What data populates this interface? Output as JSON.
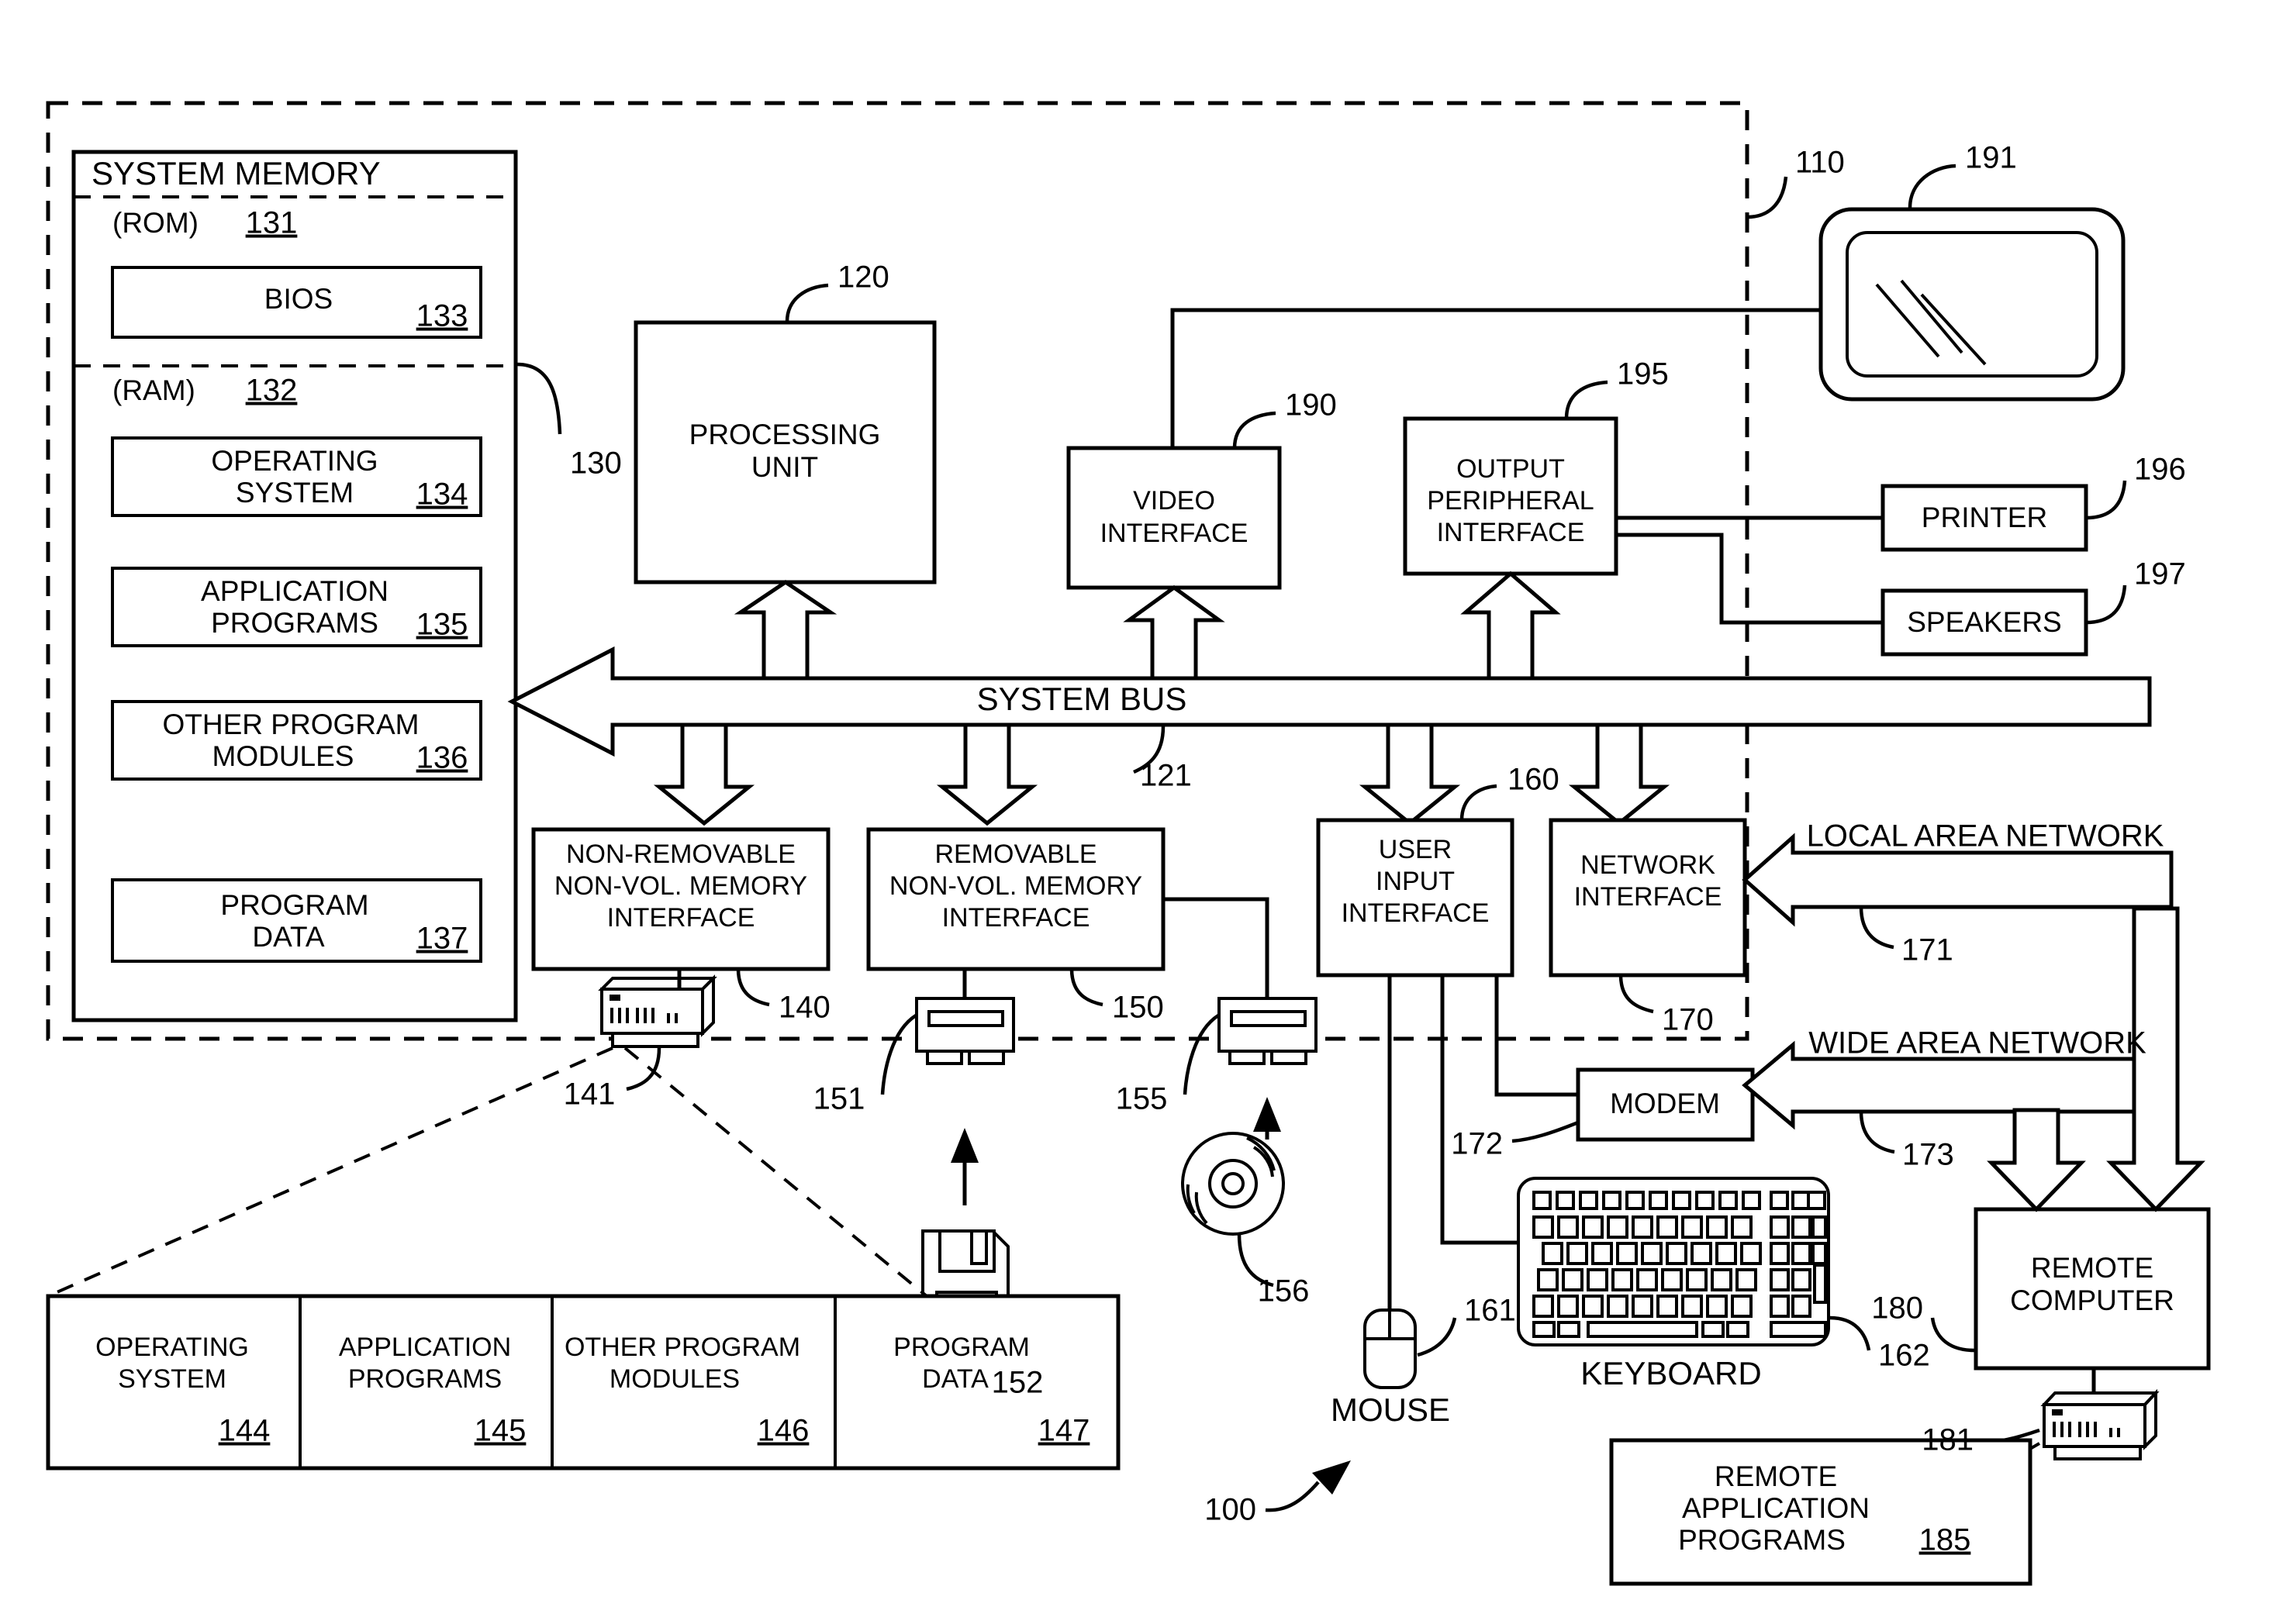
{
  "figure": {
    "system_ref": "100",
    "computer_ref": "110",
    "bus_label": "SYSTEM BUS",
    "bus_ref": "121"
  },
  "system_memory": {
    "title": "SYSTEM MEMORY",
    "ref": "130",
    "rom": {
      "label": "(ROM)",
      "ref": "131"
    },
    "bios": {
      "label": "BIOS",
      "ref": "133"
    },
    "ram": {
      "label": "(RAM)",
      "ref": "132"
    },
    "blocks": [
      {
        "line1": "OPERATING",
        "line2": "SYSTEM",
        "ref": "134"
      },
      {
        "line1": "APPLICATION",
        "line2": "PROGRAMS",
        "ref": "135"
      },
      {
        "line1": "OTHER PROGRAM",
        "line2": "MODULES",
        "ref": "136"
      },
      {
        "line1": "PROGRAM",
        "line2": "DATA",
        "ref": "137"
      }
    ]
  },
  "processing_unit": {
    "line1": "PROCESSING",
    "line2": "UNIT",
    "ref": "120"
  },
  "interfaces": {
    "video": {
      "line1": "VIDEO",
      "line2": "INTERFACE",
      "ref": "190"
    },
    "output_peripheral": {
      "line1": "OUTPUT",
      "line2": "PERIPHERAL",
      "line3": "INTERFACE",
      "ref": "195"
    },
    "non_removable": {
      "line1": "NON-REMOVABLE",
      "line2": "NON-VOL. MEMORY",
      "line3": "INTERFACE",
      "ref": "140"
    },
    "removable": {
      "line1": "REMOVABLE",
      "line2": "NON-VOL. MEMORY",
      "line3": "INTERFACE",
      "ref": "150"
    },
    "user_input": {
      "line1": "USER",
      "line2": "INPUT",
      "line3": "INTERFACE",
      "ref": "160"
    },
    "network": {
      "line1": "NETWORK",
      "line2": "INTERFACE",
      "ref": "170"
    }
  },
  "output_devices": {
    "monitor": {
      "ref": "191"
    },
    "printer": {
      "label": "PRINTER",
      "ref": "196"
    },
    "speakers": {
      "label": "SPEAKERS",
      "ref": "197"
    }
  },
  "storage_devices": {
    "hard_disk": {
      "ref": "141"
    },
    "floppy_drive": {
      "ref": "151"
    },
    "floppy_disk": {
      "ref": "152"
    },
    "optical_drive": {
      "ref": "155"
    },
    "optical_disc": {
      "ref": "156"
    }
  },
  "input_devices": {
    "mouse": {
      "label": "MOUSE",
      "ref": "161"
    },
    "keyboard": {
      "label": "KEYBOARD",
      "ref": "162"
    }
  },
  "networking": {
    "lan": {
      "label": "LOCAL AREA NETWORK",
      "ref": "171"
    },
    "wan": {
      "label": "WIDE AREA NETWORK",
      "ref": "173"
    },
    "modem": {
      "label": "MODEM",
      "ref": "172"
    },
    "remote_computer": {
      "line1": "REMOTE",
      "line2": "COMPUTER",
      "ref": "180"
    },
    "remote_hard_disk": {
      "ref": "181"
    },
    "remote_app_programs": {
      "line1": "REMOTE",
      "line2": "APPLICATION",
      "line3": "PROGRAMS",
      "ref": "185"
    }
  },
  "disk_contents": {
    "columns": [
      {
        "line1": "OPERATING",
        "line2": "SYSTEM",
        "ref": "144"
      },
      {
        "line1": "APPLICATION",
        "line2": "PROGRAMS",
        "ref": "145"
      },
      {
        "line1": "OTHER PROGRAM",
        "line2": "MODULES",
        "ref": "146"
      },
      {
        "line1": "PROGRAM",
        "line2": "DATA",
        "ref": "147"
      }
    ]
  }
}
